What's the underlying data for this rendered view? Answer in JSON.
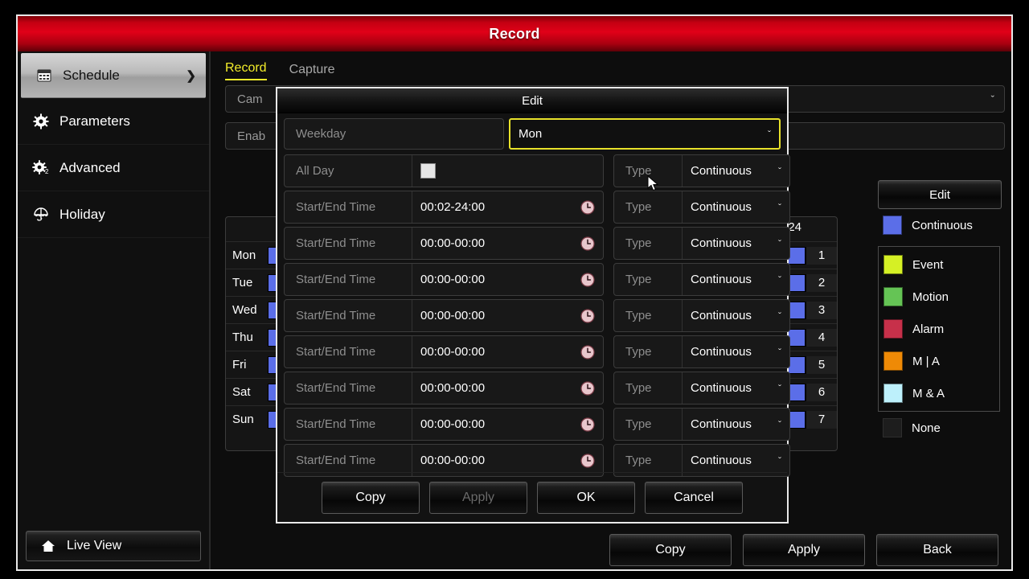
{
  "window": {
    "title": "Record"
  },
  "sidebar": {
    "items": [
      {
        "label": "Schedule",
        "icon": "calendar-icon",
        "active": true,
        "arrow": "❯"
      },
      {
        "label": "Parameters",
        "icon": "gear-icon",
        "active": false,
        "arrow": ""
      },
      {
        "label": "Advanced",
        "icon": "gear-two-icon",
        "active": false,
        "arrow": ""
      },
      {
        "label": "Holiday",
        "icon": "umbrella-icon",
        "active": false,
        "arrow": ""
      }
    ],
    "live_view": {
      "label": "Live View",
      "icon": "home-icon"
    }
  },
  "main": {
    "tabs": [
      {
        "label": "Record",
        "active": true
      },
      {
        "label": "Capture",
        "active": false
      }
    ],
    "camera_row": {
      "label": "Cam",
      "value": "",
      "caret": "ˇ"
    },
    "enable_row": {
      "label": "Enab",
      "value": ""
    },
    "schedule": {
      "hour_end_label": "24",
      "days": [
        "Mon",
        "Tue",
        "Wed",
        "Thu",
        "Fri",
        "Sat",
        "Sun"
      ],
      "row_numbers": [
        "1",
        "2",
        "3",
        "4",
        "5",
        "6",
        "7"
      ],
      "bar_color": "#5b6ee8",
      "bar_type": "Continuous"
    },
    "legend": {
      "edit_label": "Edit",
      "top_entry": {
        "label": "Continuous",
        "color": "#5b6ee8"
      },
      "grouped": [
        {
          "label": "Event",
          "color": "#d5f025"
        },
        {
          "label": "Motion",
          "color": "#6cc council"
        }
      ],
      "entries": [
        {
          "label": "Event",
          "color": "#d5f025"
        },
        {
          "label": "Motion",
          "color": "#65c455"
        },
        {
          "label": "Alarm",
          "color": "#c7304a"
        },
        {
          "label": "M | A",
          "color": "#ef8a06"
        },
        {
          "label": "M & A",
          "color": "#bdf0fb"
        }
      ],
      "none_entry": {
        "label": "None",
        "color": "#1d1d1d"
      }
    },
    "buttons": [
      {
        "label": "Copy",
        "disabled": false
      },
      {
        "label": "Apply",
        "disabled": false
      },
      {
        "label": "Back",
        "disabled": false
      }
    ]
  },
  "dialog": {
    "title": "Edit",
    "weekday": {
      "label": "Weekday",
      "value": "Mon",
      "caret": "ˇ"
    },
    "all_day": {
      "label": "All Day",
      "checked": false
    },
    "type_label": "Type",
    "type_value": "Continuous",
    "type_caret": "ˇ",
    "rows": [
      {
        "label": "Start/End Time",
        "value": "00:02-24:00",
        "type_label": "Type",
        "type_value": "Continuous"
      },
      {
        "label": "Start/End Time",
        "value": "00:00-00:00",
        "type_label": "Type",
        "type_value": "Continuous"
      },
      {
        "label": "Start/End Time",
        "value": "00:00-00:00",
        "type_label": "Type",
        "type_value": "Continuous"
      },
      {
        "label": "Start/End Time",
        "value": "00:00-00:00",
        "type_label": "Type",
        "type_value": "Continuous"
      },
      {
        "label": "Start/End Time",
        "value": "00:00-00:00",
        "type_label": "Type",
        "type_value": "Continuous"
      },
      {
        "label": "Start/End Time",
        "value": "00:00-00:00",
        "type_label": "Type",
        "type_value": "Continuous"
      },
      {
        "label": "Start/End Time",
        "value": "00:00-00:00",
        "type_label": "Type",
        "type_value": "Continuous"
      },
      {
        "label": "Start/End Time",
        "value": "00:00-00:00",
        "type_label": "Type",
        "type_value": "Continuous"
      }
    ],
    "buttons": [
      {
        "label": "Copy",
        "disabled": false
      },
      {
        "label": "Apply",
        "disabled": true
      },
      {
        "label": "OK",
        "disabled": false
      },
      {
        "label": "Cancel",
        "disabled": false
      }
    ]
  }
}
